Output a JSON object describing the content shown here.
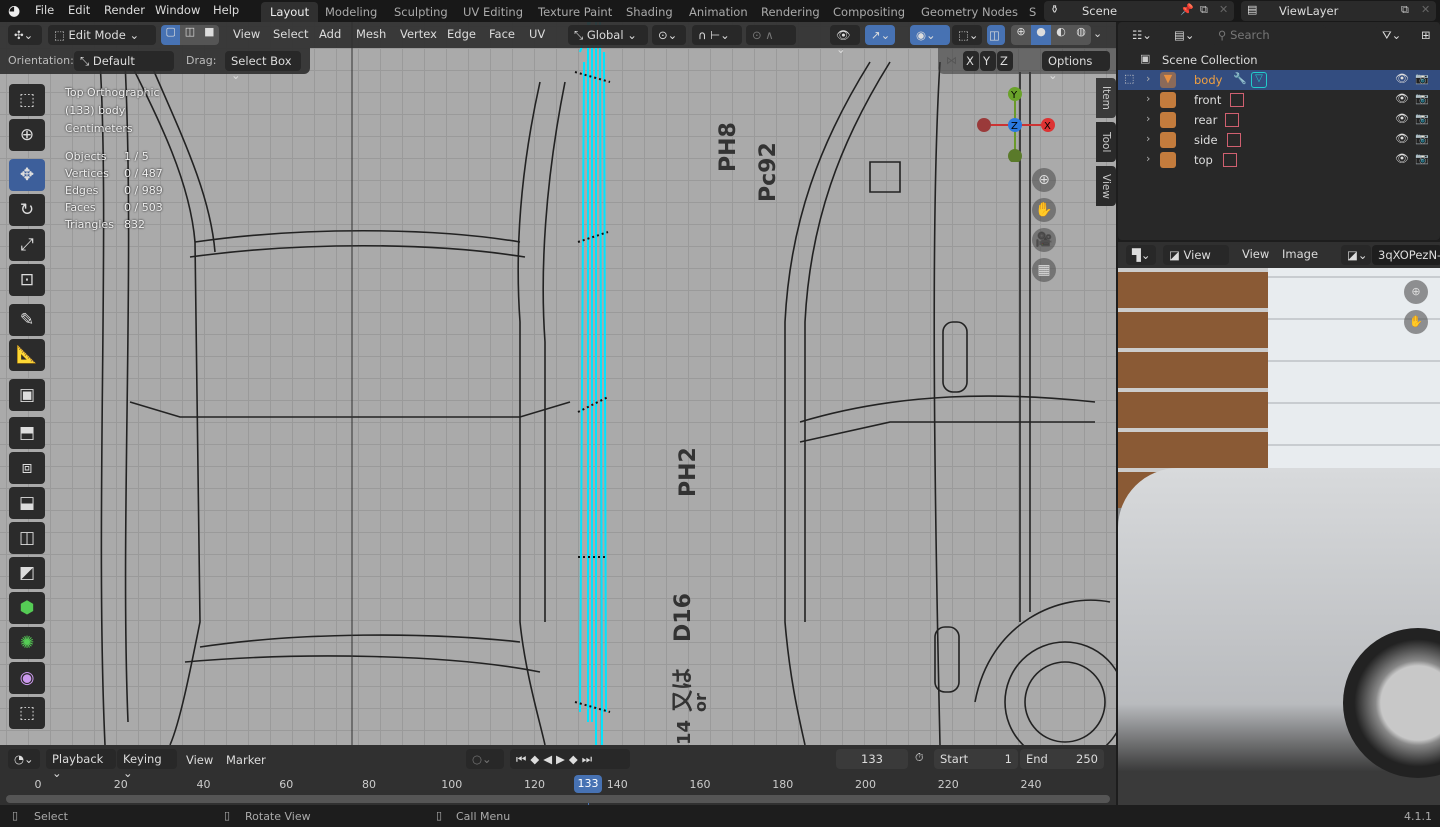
{
  "topbar": {
    "menus": [
      "File",
      "Edit",
      "Render",
      "Window",
      "Help"
    ],
    "workspaces": [
      "Layout",
      "Modeling",
      "Sculpting",
      "UV Editing",
      "Texture Paint",
      "Shading",
      "Animation",
      "Rendering",
      "Compositing",
      "Geometry Nodes",
      "S"
    ],
    "active_workspace": "Layout",
    "scene": "Scene",
    "view_layer": "ViewLayer"
  },
  "viewport": {
    "mode": "Edit Mode",
    "menus": [
      "View",
      "Select",
      "Add",
      "Mesh",
      "Vertex",
      "Edge",
      "Face",
      "UV"
    ],
    "transform_orientation": "Global",
    "orientation_label": "Orientation:",
    "orientation": "Default",
    "drag_label": "Drag:",
    "drag": "Select Box",
    "axes": [
      "X",
      "Y",
      "Z"
    ],
    "options": "Options",
    "overlay": {
      "view": "Top Orthographic",
      "object": "(133) body",
      "units": "Centimeters",
      "stats": [
        {
          "label": "Objects",
          "value": "1 / 5"
        },
        {
          "label": "Vertices",
          "value": "0 / 487"
        },
        {
          "label": "Edges",
          "value": "0 / 989"
        },
        {
          "label": "Faces",
          "value": "0 / 503"
        },
        {
          "label": "Triangles",
          "value": "832"
        }
      ]
    },
    "gizmo": {
      "x": "X",
      "y": "Y",
      "z": "Z"
    },
    "side_tabs": [
      "Item",
      "Tool",
      "View"
    ],
    "blueprint_text": [
      "PH8",
      "Pc92",
      "PH2",
      "D16",
      "又は",
      "or",
      "14"
    ]
  },
  "outliner": {
    "search_placeholder": "Search",
    "root": "Scene Collection",
    "items": [
      {
        "name": "body",
        "selected": true
      },
      {
        "name": "front"
      },
      {
        "name": "rear"
      },
      {
        "name": "side"
      },
      {
        "name": "top"
      }
    ]
  },
  "image_editor": {
    "mode": "View",
    "menus": [
      "View",
      "Image"
    ],
    "image_name": "3qXOPezN-"
  },
  "timeline": {
    "menus": [
      "Playback",
      "Keying",
      "View",
      "Marker"
    ],
    "current_frame": "133",
    "start_label": "Start",
    "start": "1",
    "end_label": "End",
    "end": "250",
    "ticks": [
      "0",
      "20",
      "40",
      "60",
      "80",
      "100",
      "120",
      "140",
      "160",
      "180",
      "200",
      "220",
      "240"
    ]
  },
  "status": {
    "items": [
      "Select",
      "Rotate View",
      "Call Menu"
    ],
    "version": "4.1.1"
  },
  "colors": {
    "accent": "#4772b3",
    "selection": "#334d80",
    "mesh": "#00e5ff"
  }
}
